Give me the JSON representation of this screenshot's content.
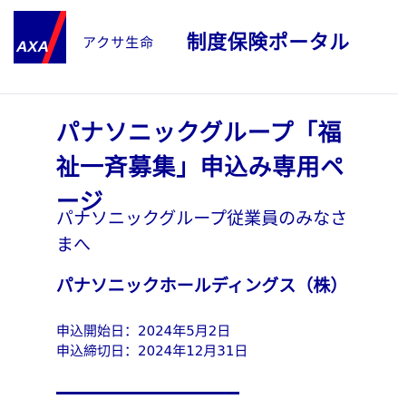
{
  "header": {
    "logo_text": "AXA",
    "brand_name": "アクサ生命",
    "portal_title": "制度保険ポータル"
  },
  "main": {
    "title": "パナソニックグループ「福祉一斉募集」申込み専用ページ",
    "subtitle": "パナソニックグループ従業員のみなさまへ",
    "company": "パナソニックホールディングス（株）",
    "dates": [
      {
        "label": "申込開始日",
        "value": "2024年5月2日"
      },
      {
        "label": "申込締切日",
        "value": "2024年12月31日"
      }
    ]
  },
  "colors": {
    "brand_blue": "#00008f",
    "logo_red": "#ff1721"
  }
}
